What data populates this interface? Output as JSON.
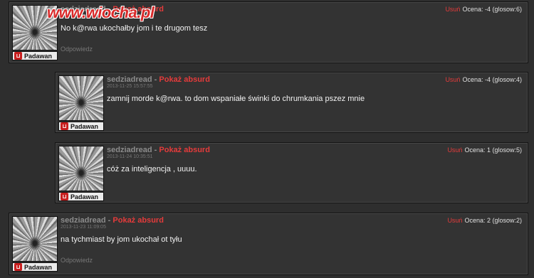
{
  "watermark": "www.wiocha.pl",
  "colors": {
    "accent": "#e53b3b",
    "panel": "#333333",
    "background": "#2e2e2e"
  },
  "comments": [
    {
      "author": "sedziadread",
      "separator": "-",
      "flag": "Pokaż absurd",
      "date": "",
      "rank": "Padawan",
      "delete": "Usuń",
      "rating": "Ocena: -4 (glosow:6)",
      "text": "No k@rwa ukochałby jom i te drugom tesz",
      "reply": "Odpowiedz"
    },
    {
      "author": "sedziadread",
      "separator": "-",
      "flag": "Pokaż absurd",
      "date": "2013-11-25 15:57:55",
      "rank": "Padawan",
      "delete": "Usuń",
      "rating": "Ocena: -4 (glosow:4)",
      "text": "zamnij morde k@rwa. to dom wspaniałe świnki do chrumkania pszez mnie",
      "reply": ""
    },
    {
      "author": "sedziadread",
      "separator": "-",
      "flag": "Pokaż absurd",
      "date": "2013-11-24 10:35:51",
      "rank": "Padawan",
      "delete": "Usuń",
      "rating": "Ocena: 1 (glosow:5)",
      "text": "cóż za inteligencja , uuuu.",
      "reply": ""
    },
    {
      "author": "sedziadread",
      "separator": "-",
      "flag": "Pokaż absurd",
      "date": "2013-11-23 11:09:05",
      "rank": "Padawan",
      "delete": "Usuń",
      "rating": "Ocena: 2 (glosow:2)",
      "text": "na tychmiast by jom ukochał ot tyłu",
      "reply": "Odpowiedz"
    }
  ]
}
